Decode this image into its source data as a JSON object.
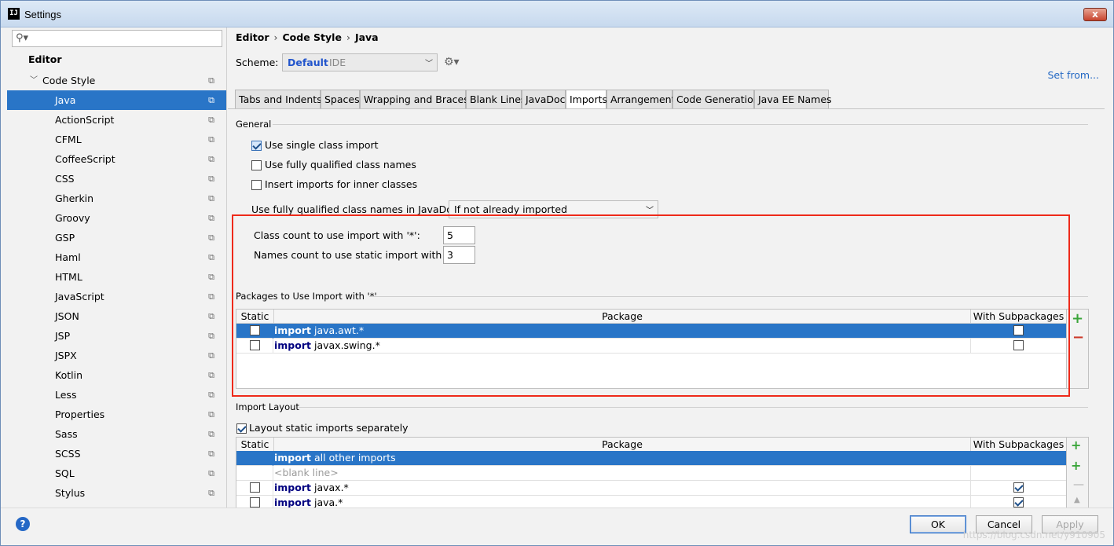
{
  "window": {
    "title": "Settings",
    "app_icon": "IJ",
    "close_label": "x"
  },
  "sidebar": {
    "search_placeholder": "",
    "header": "Editor",
    "code_style": "Code Style",
    "items": [
      "Java",
      "ActionScript",
      "CFML",
      "CoffeeScript",
      "CSS",
      "Gherkin",
      "Groovy",
      "GSP",
      "Haml",
      "HTML",
      "JavaScript",
      "JSON",
      "JSP",
      "JSPX",
      "Kotlin",
      "Less",
      "Properties",
      "Sass",
      "SCSS",
      "SQL",
      "Stylus"
    ],
    "selected": "Java"
  },
  "breadcrumb": {
    "a": "Editor",
    "b": "Code Style",
    "c": "Java",
    "sep": "›"
  },
  "scheme": {
    "label": "Scheme:",
    "value": "Default",
    "suffix": "IDE",
    "set_from": "Set from..."
  },
  "tabs": [
    "Tabs and Indents",
    "Spaces",
    "Wrapping and Braces",
    "Blank Lines",
    "JavaDoc",
    "Imports",
    "Arrangement",
    "Code Generation",
    "Java EE Names"
  ],
  "active_tab": "Imports",
  "general": {
    "title": "General",
    "single_class_import": "Use single class import",
    "fully_qualified": "Use fully qualified class names",
    "inner_classes": "Insert imports for inner classes",
    "javadoc_label": "Use fully qualified class names in JavaDoc:",
    "javadoc_value": "If not already imported",
    "class_count_label": "Class count to use import with '*':",
    "class_count_value": "5",
    "names_count_label": "Names count to use static import with '*':",
    "names_count_value": "3"
  },
  "packages": {
    "title": "Packages to Use Import with '*'",
    "col_static": "Static",
    "col_package": "Package",
    "col_sub": "With Subpackages",
    "rows": [
      {
        "kw": "import",
        "pkg": "java.awt.*"
      },
      {
        "kw": "import",
        "pkg": "javax.swing.*"
      }
    ]
  },
  "layout": {
    "title": "Import Layout",
    "separately": "Layout static imports separately",
    "col_static": "Static",
    "col_package": "Package",
    "col_sub": "With Subpackages",
    "row1_kw": "import",
    "row1_pkg": "all other imports",
    "row2": "<blank line>",
    "row3_kw": "import",
    "row3_pkg": "javax.*",
    "row4_kw": "import",
    "row4_pkg": "java.*"
  },
  "footer": {
    "help": "?",
    "ok": "OK",
    "cancel": "Cancel",
    "apply": "Apply",
    "watermark": "https://blog.csdn.net/y910905"
  },
  "colors": {
    "accent": "#2975c7",
    "highlight_box": "#ee2a1a",
    "link": "#2469c4"
  }
}
